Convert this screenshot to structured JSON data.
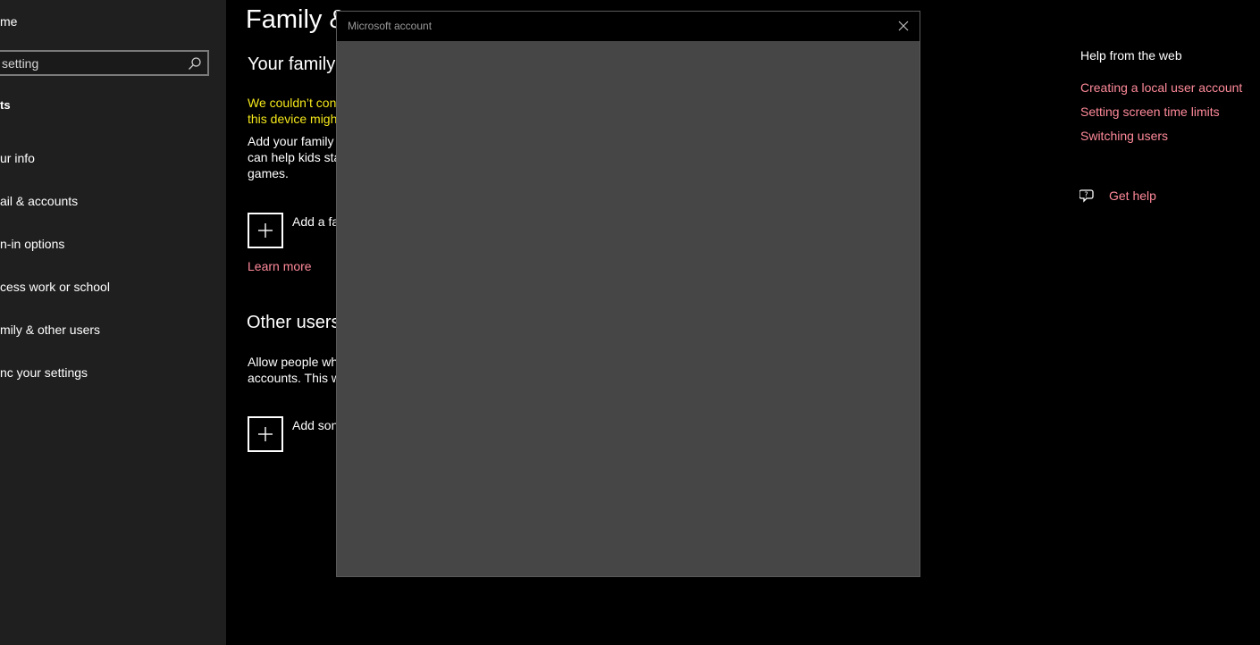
{
  "sidebar": {
    "home_label": "me",
    "search_placeholder": "setting",
    "section_label": "ts",
    "items": [
      {
        "label": "ur info"
      },
      {
        "label": "ail & accounts"
      },
      {
        "label": "n-in options"
      },
      {
        "label": "cess work or school"
      },
      {
        "label": "mily & other users"
      },
      {
        "label": "nc your settings"
      }
    ]
  },
  "main": {
    "title": "Family &",
    "family_heading": "Your family",
    "warning_lines": [
      "We couldn’t con",
      "this device migh"
    ],
    "family_desc_lines": [
      "Add your family",
      "can help kids sta",
      "games."
    ],
    "add_family_label": "Add a fa",
    "learn_more": "Learn more",
    "other_users_heading": "Other users",
    "other_users_desc_lines": [
      "Allow people wh",
      "accounts. This w"
    ],
    "add_someone_label": "Add son"
  },
  "dialog": {
    "title": "Microsoft account"
  },
  "help": {
    "title": "Help from the web",
    "links": [
      "Creating a local user account",
      "Setting screen time limits",
      "Switching users"
    ],
    "get_help": "Get help"
  },
  "colors": {
    "accent_link": "#ff8a9a",
    "warning": "#f5e81b",
    "sidebar_bg": "#1f1f1f",
    "dialog_bg": "#464646"
  },
  "icons": {
    "search": "search-icon",
    "close": "close-icon",
    "add": "plus-icon",
    "get_help": "chat-help-icon"
  }
}
